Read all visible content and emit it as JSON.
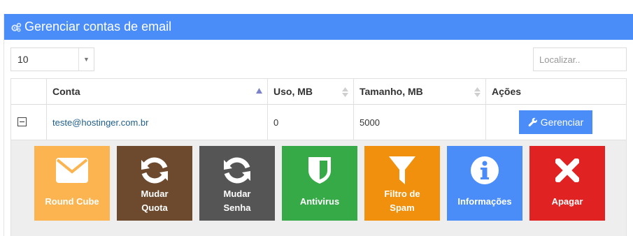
{
  "header": {
    "title": "Gerenciar contas de email",
    "icon": "gears-icon",
    "color": "#4b8df8"
  },
  "length_select": {
    "value": "10"
  },
  "search": {
    "placeholder": "Localizar.."
  },
  "table": {
    "columns": [
      "",
      "Conta",
      "Uso, MB",
      "Tamanho, MB",
      "Ações"
    ],
    "sorted_column": "Conta",
    "rows": [
      {
        "conta": "teste@hostinger.com.br",
        "uso": "0",
        "tamanho": "5000",
        "action_label": "Gerenciar"
      }
    ]
  },
  "actions": [
    {
      "label": "Round Cube",
      "icon": "envelope-icon",
      "color": "#fbb450"
    },
    {
      "label": "Mudar\nQuota",
      "icon": "refresh-icon",
      "color": "#6d4a2d"
    },
    {
      "label": "Mudar\nSenha",
      "icon": "refresh-icon",
      "color": "#555555"
    },
    {
      "label": "Antivirus",
      "icon": "shield-icon",
      "color": "#35aa47"
    },
    {
      "label": "Filtro de\nSpam",
      "icon": "filter-icon",
      "color": "#f0900c"
    },
    {
      "label": "Informações",
      "icon": "info-icon",
      "color": "#4b8df8"
    },
    {
      "label": "Apagar",
      "icon": "close-icon",
      "color": "#e02222"
    }
  ]
}
